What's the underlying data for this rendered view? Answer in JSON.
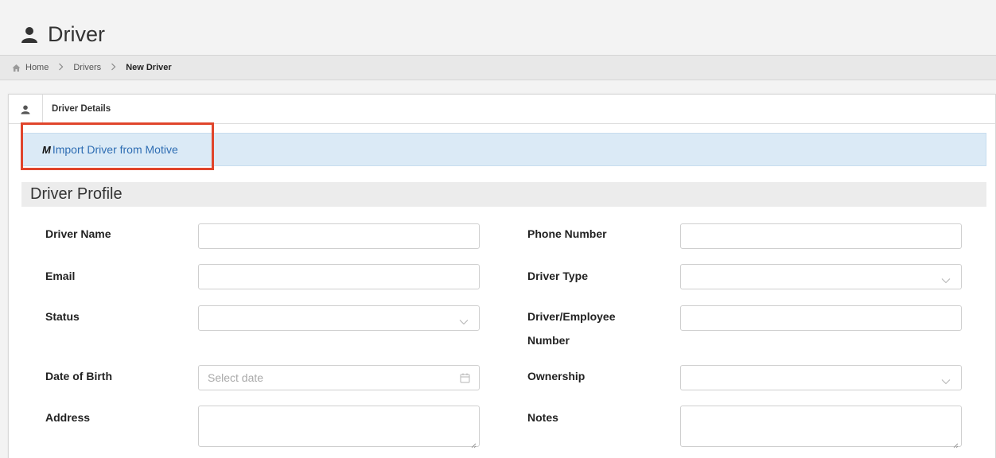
{
  "page": {
    "title": "Driver"
  },
  "breadcrumb": {
    "home": "Home",
    "drivers": "Drivers",
    "current": "New Driver"
  },
  "panel": {
    "title": "Driver Details"
  },
  "import": {
    "motive_mark": "M",
    "label": "Import Driver from Motive"
  },
  "section": {
    "title": "Driver Profile"
  },
  "form": {
    "driver_name": {
      "label": "Driver Name",
      "value": ""
    },
    "phone_number": {
      "label": "Phone Number",
      "value": ""
    },
    "email": {
      "label": "Email",
      "value": ""
    },
    "driver_type": {
      "label": "Driver Type",
      "value": ""
    },
    "status": {
      "label": "Status",
      "value": ""
    },
    "employee_number": {
      "label_line1": "Driver/Employee",
      "label_line2": "Number",
      "value": ""
    },
    "date_of_birth": {
      "label": "Date of Birth",
      "placeholder": "Select date"
    },
    "ownership": {
      "label": "Ownership",
      "value": ""
    },
    "address": {
      "label": "Address",
      "value": ""
    },
    "notes": {
      "label": "Notes",
      "value": ""
    }
  },
  "colors": {
    "accent_link": "#2e6db3",
    "highlight": "#e0452c",
    "alert_bg": "#dbeaf6"
  }
}
